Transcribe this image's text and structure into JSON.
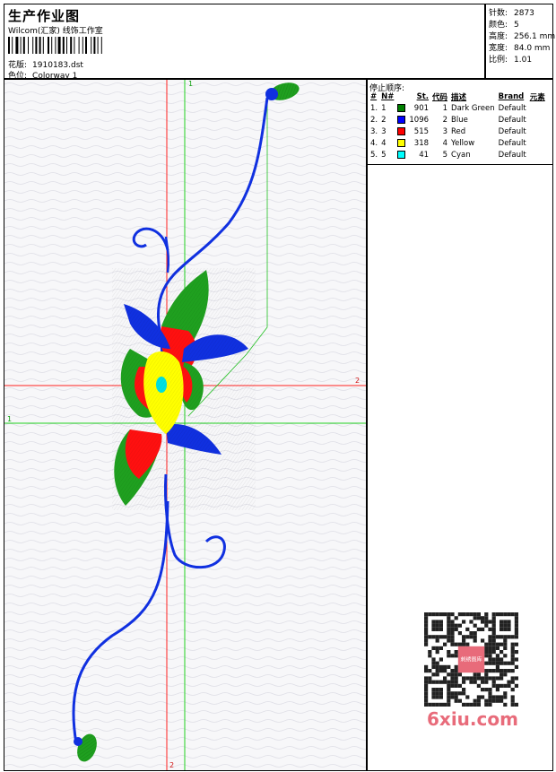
{
  "header": {
    "title": "生产作业图",
    "company": "Wilcom(汇家) 线饰工作室",
    "design_label": "花版:",
    "design_value": "1910183.dst",
    "colorway_label": "色位:",
    "colorway_value": "Colorway 1"
  },
  "stats": {
    "stitches_label": "针数:",
    "stitches_value": "2873",
    "colors_label": "颜色:",
    "colors_value": "5",
    "height_label": "高度:",
    "height_value": "256.1 mm",
    "width_label": "宽度:",
    "width_value": "84.0 mm",
    "scale_label": "比例:",
    "scale_value": "1.01"
  },
  "stop_sequence": {
    "title": "停止顺序:",
    "headers": [
      "#",
      "N#",
      "",
      "St.",
      "代码",
      "描述",
      "Brand",
      "元素"
    ],
    "rows": [
      {
        "idx": "1.",
        "n": "1",
        "color": "#008000",
        "st": "901",
        "code": "1",
        "desc": "Dark Green",
        "brand": "Default"
      },
      {
        "idx": "2.",
        "n": "2",
        "color": "#0000ff",
        "st": "1096",
        "code": "2",
        "desc": "Blue",
        "brand": "Default"
      },
      {
        "idx": "3.",
        "n": "3",
        "color": "#ff0000",
        "st": "515",
        "code": "3",
        "desc": "Red",
        "brand": "Default"
      },
      {
        "idx": "4.",
        "n": "4",
        "color": "#ffff00",
        "st": "318",
        "code": "4",
        "desc": "Yellow",
        "brand": "Default"
      },
      {
        "idx": "5.",
        "n": "5",
        "color": "#00ffff",
        "st": "41",
        "code": "5",
        "desc": "Cyan",
        "brand": "Default"
      }
    ]
  },
  "canvas": {
    "axis_green_label": "1",
    "axis_red_label": "2"
  },
  "watermark": {
    "text": "6xiu.com",
    "qr_caption": "刺绣图库"
  }
}
